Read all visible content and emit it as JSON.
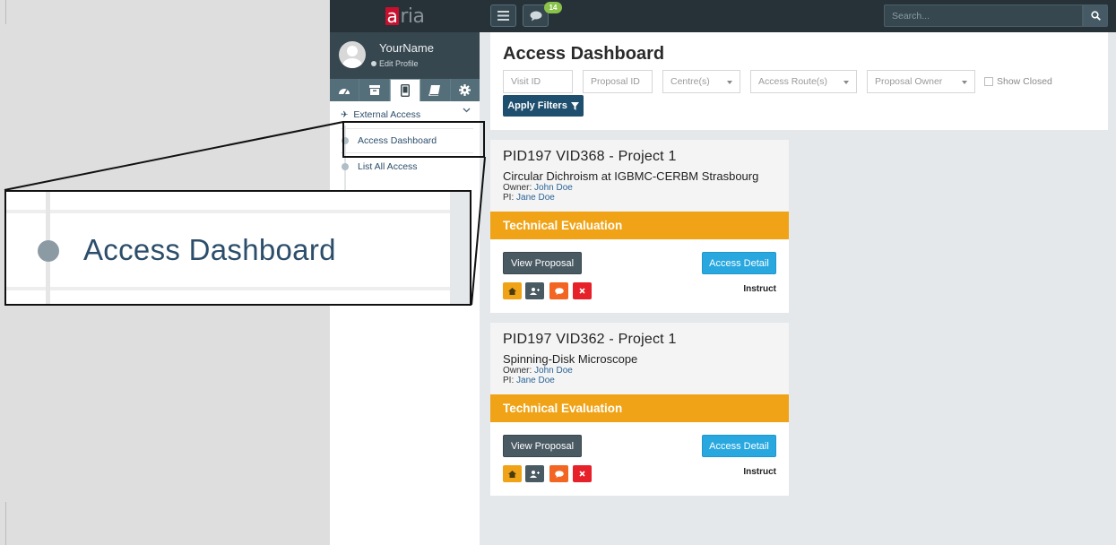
{
  "brand": {
    "logo_mark": "a",
    "logo_text": "ria"
  },
  "profile": {
    "name": "YourName",
    "edit_label": "Edit Profile"
  },
  "sidebar_tabs": [
    {
      "icon": "dashboard-icon"
    },
    {
      "icon": "archive-icon"
    },
    {
      "icon": "tablet-icon",
      "active": true
    },
    {
      "icon": "book-icon"
    },
    {
      "icon": "gear-icon"
    }
  ],
  "menu": {
    "section_label": "External Access",
    "items": [
      {
        "label": "Access Dashboard",
        "active": true
      },
      {
        "label": "List All Access"
      }
    ]
  },
  "topbar": {
    "messages_count": "14",
    "search_placeholder": "Search..."
  },
  "main": {
    "title": "Access Dashboard"
  },
  "filters": {
    "visit_id_placeholder": "Visit ID",
    "proposal_id_placeholder": "Proposal ID",
    "centre_label": "Centre(s)",
    "access_route_label": "Access Route(s)",
    "proposal_owner_label": "Proposal Owner",
    "show_closed_label": "Show Closed",
    "apply_label": "Apply Filters"
  },
  "cards": [
    {
      "title": "PID197 VID368 - Project 1",
      "subtitle": "Circular Dichroism at IGBMC-CERBM Strasbourg",
      "owner_label": "Owner:",
      "owner": "John Doe",
      "pi_label": "PI:",
      "pi": "Jane Doe",
      "status": "Technical Evaluation",
      "view_label": "View Proposal",
      "access_label": "Access Detail",
      "instruct_label": "Instruct"
    },
    {
      "title": "PID197 VID362 - Project 1",
      "subtitle": "Spinning-Disk Microscope",
      "owner_label": "Owner:",
      "owner": "John Doe",
      "pi_label": "PI:",
      "pi": "Jane Doe",
      "status": "Technical Evaluation",
      "view_label": "View Proposal",
      "access_label": "Access Detail",
      "instruct_label": "Instruct"
    }
  ],
  "zoom": {
    "label": "Access Dashboard"
  },
  "colors": {
    "navbar": "#263238",
    "status_bar": "#f0a316",
    "primary_dark": "#1f4f6e",
    "info": "#29a8e0",
    "danger": "#e62129"
  }
}
